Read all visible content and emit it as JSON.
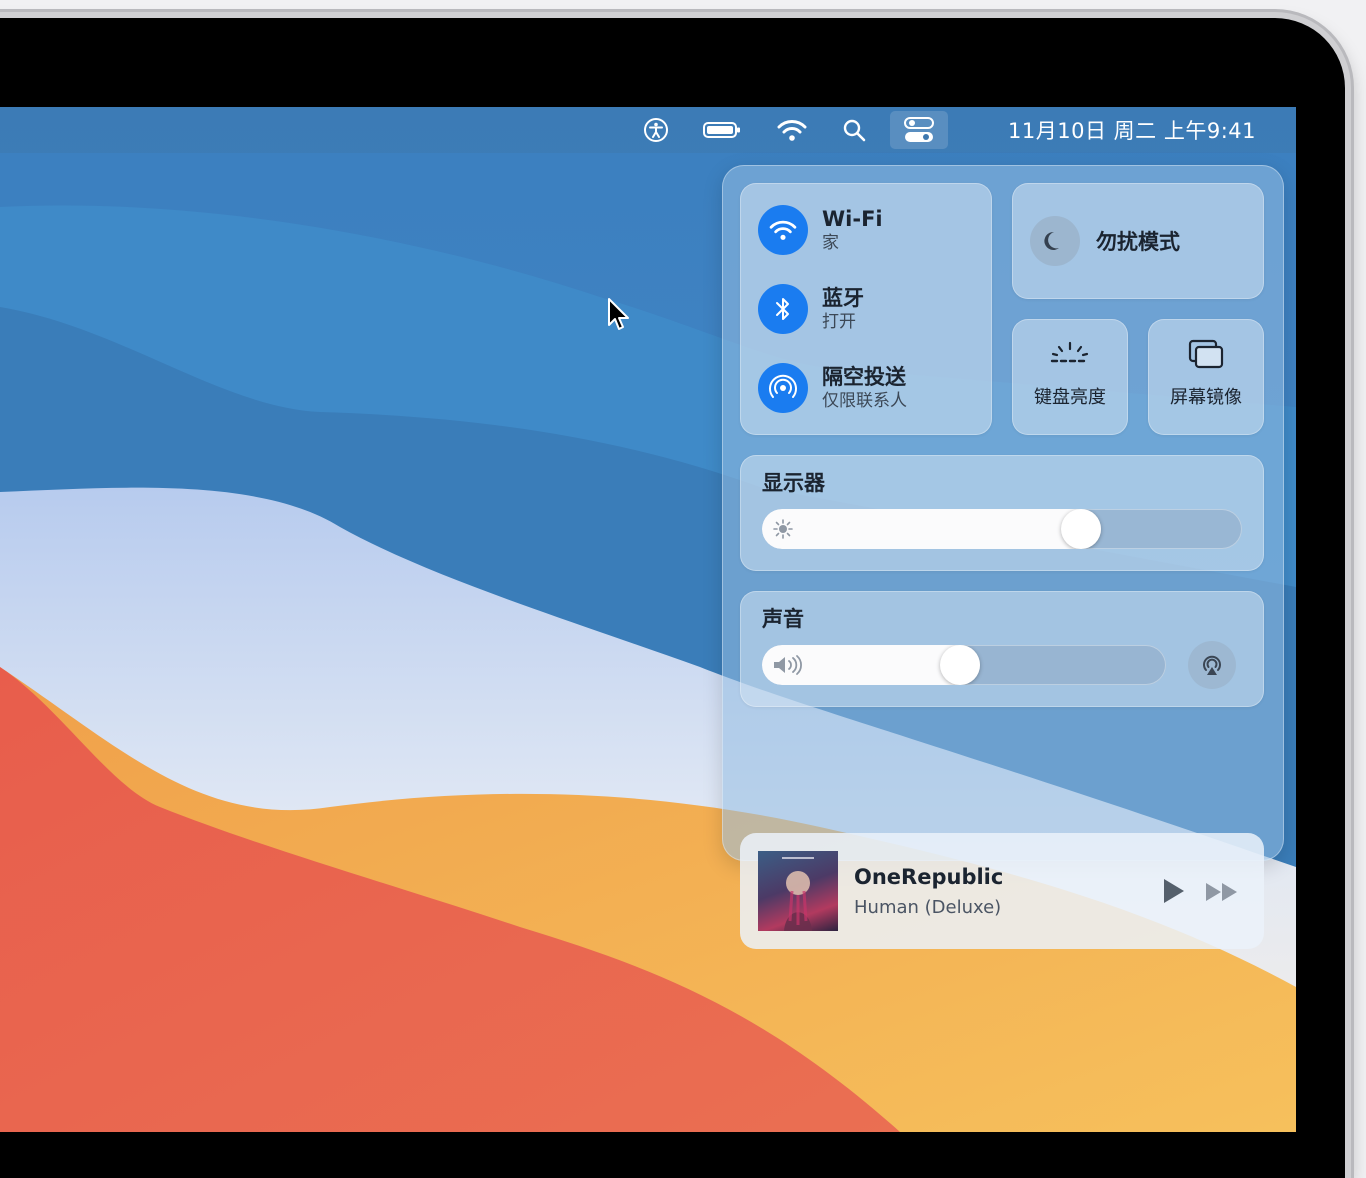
{
  "menubar": {
    "clock": "11月10日 周二 上午9:41",
    "icons": [
      "accessibility-icon",
      "battery-icon",
      "wifi-icon",
      "search-icon",
      "control-center-icon"
    ]
  },
  "control_center": {
    "network": {
      "wifi": {
        "title": "Wi-Fi",
        "subtitle": "家"
      },
      "bluetooth": {
        "title": "蓝牙",
        "subtitle": "打开"
      },
      "airdrop": {
        "title": "隔空投送",
        "subtitle": "仅限联系人"
      }
    },
    "do_not_disturb": {
      "label": "勿扰模式"
    },
    "keyboard_brightness": {
      "label": "键盘亮度"
    },
    "screen_mirroring": {
      "label": "屏幕镜像"
    },
    "display": {
      "title": "显示器",
      "level": 0.68
    },
    "sound": {
      "title": "声音",
      "level": 0.49
    },
    "now_playing": {
      "artist": "OneRepublic",
      "album": "Human (Deluxe)"
    }
  },
  "colors": {
    "accent": "#1a7cf0",
    "wallpaper_blue": "#3f86c3",
    "wallpaper_orange": "#f2a548",
    "wallpaper_red": "#e8604c"
  }
}
